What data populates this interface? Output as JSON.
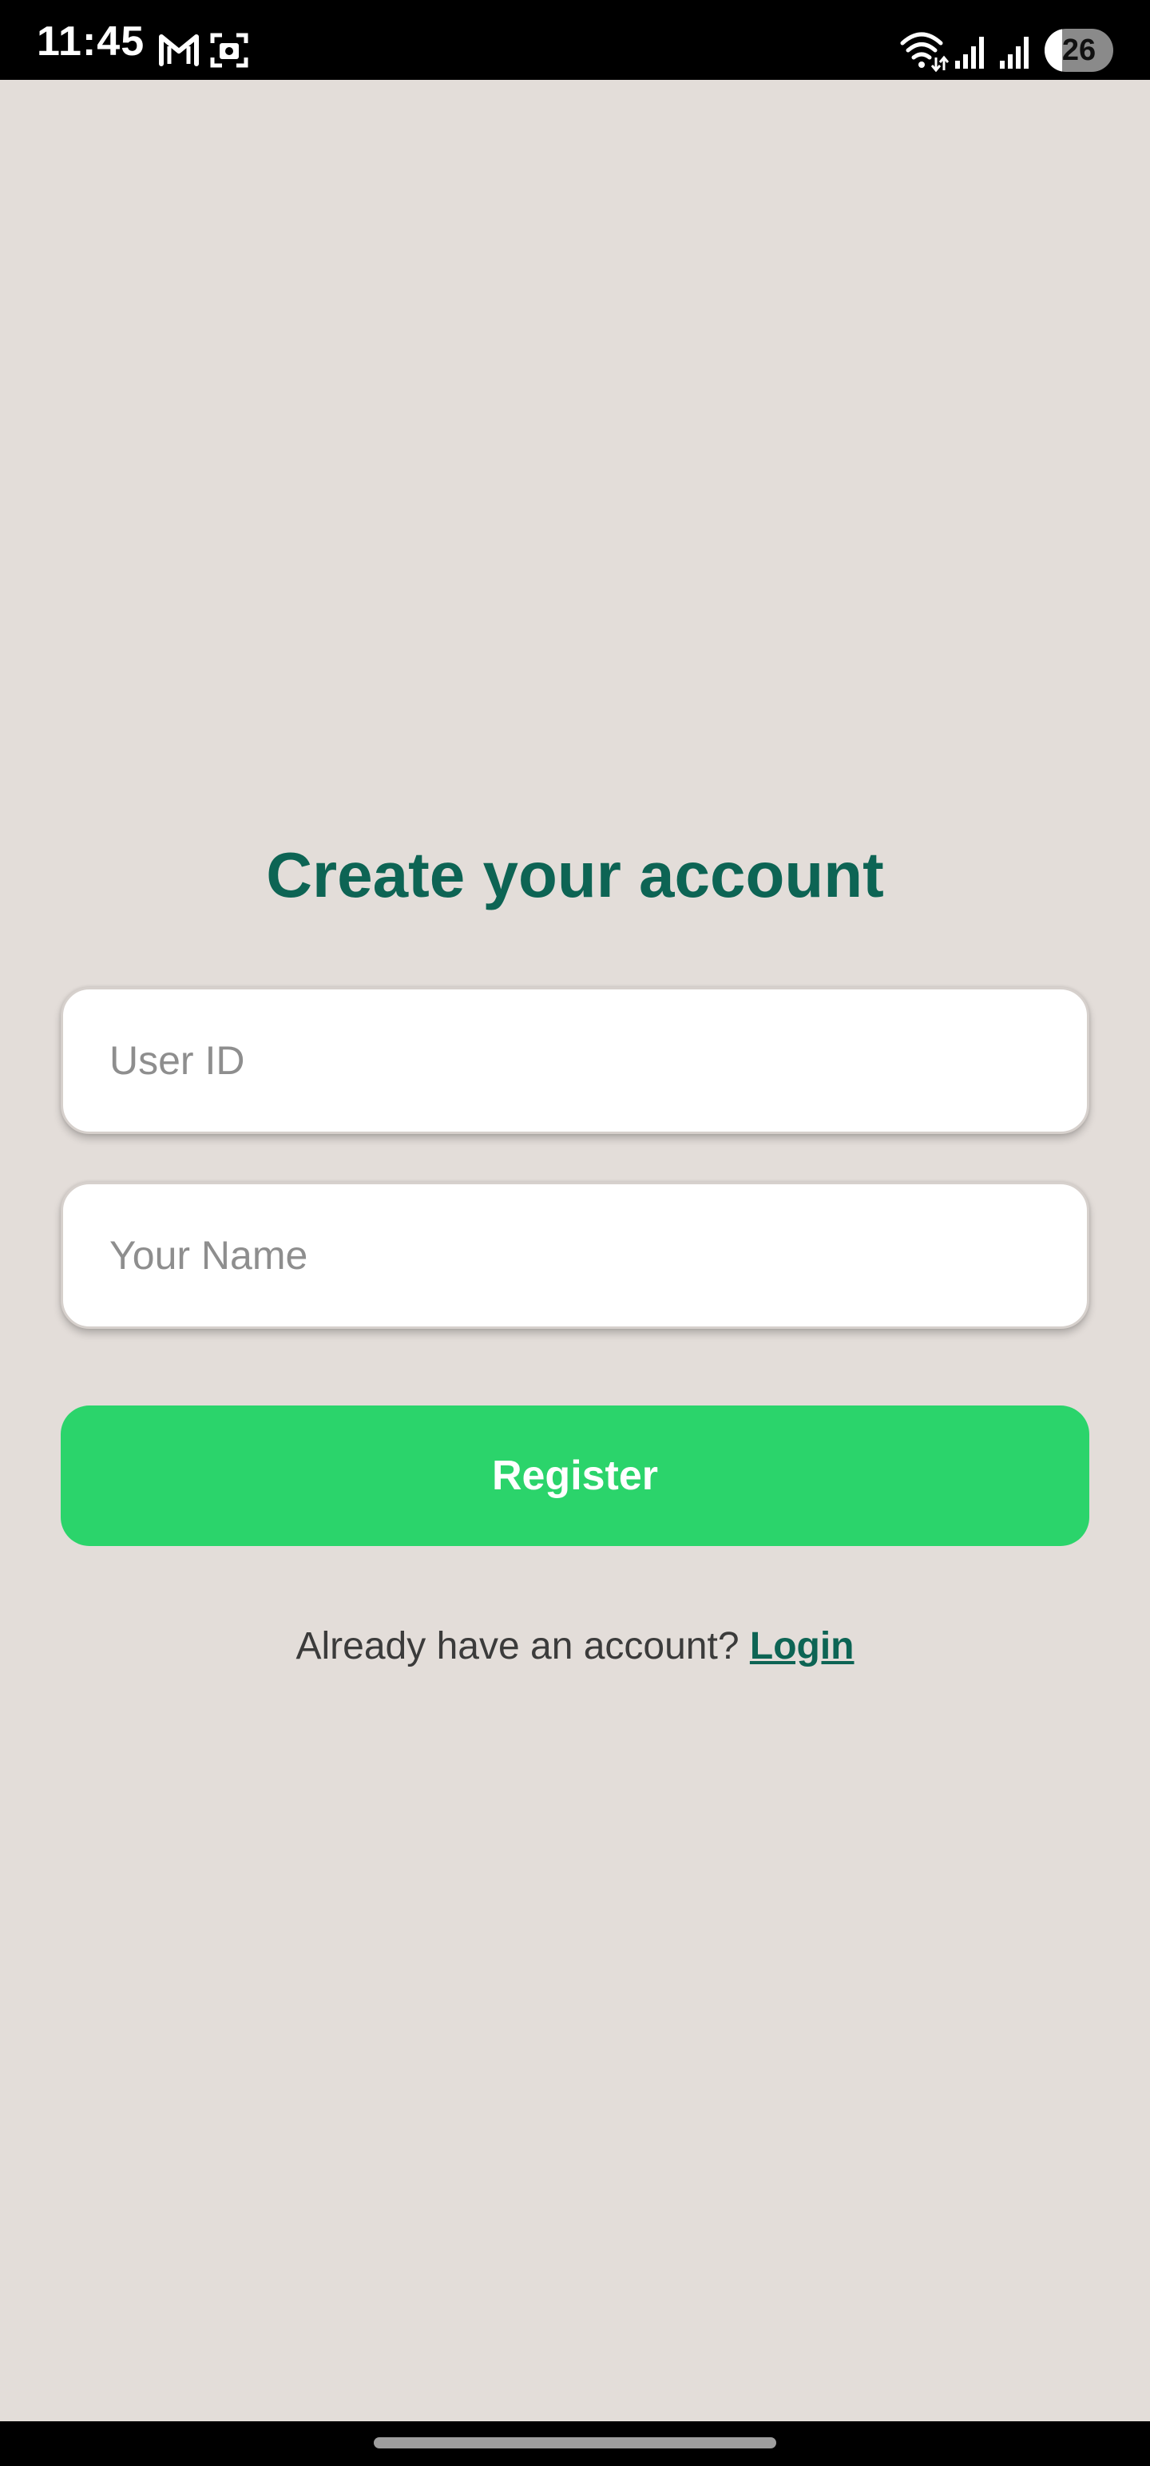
{
  "status_bar": {
    "time": "11:45",
    "battery_level": "26",
    "icons": [
      "gmail-icon",
      "screenshot-icon",
      "wifi-icon",
      "signal-icon",
      "signal-icon",
      "battery-icon"
    ]
  },
  "register": {
    "title": "Create your account",
    "user_id_placeholder": "User ID",
    "user_id_value": "",
    "name_placeholder": "Your Name",
    "name_value": "",
    "register_label": "Register",
    "login_prompt": "Already have an account?",
    "login_link": "Login"
  },
  "colors": {
    "background": "#e3ddd9",
    "title": "#0d6454",
    "button": "#2bd46b",
    "link": "#0d6454"
  }
}
